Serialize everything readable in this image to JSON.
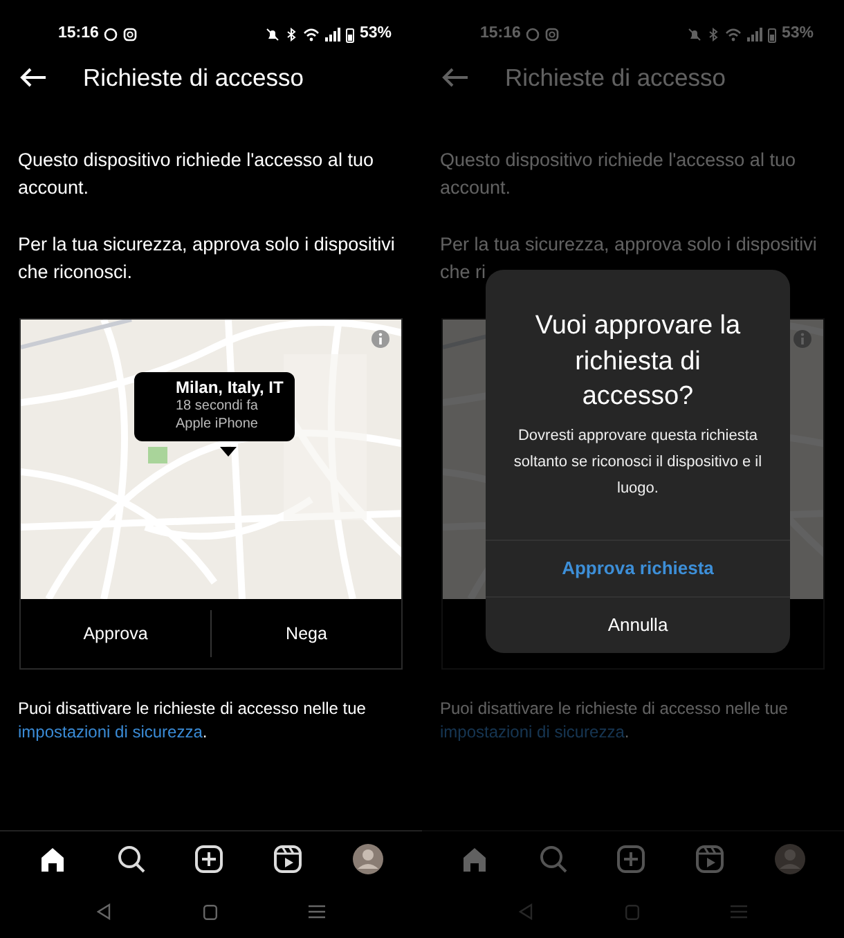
{
  "screens": [
    {
      "dimmed": false,
      "status": {
        "time": "15:16",
        "battery": "53%"
      },
      "title": "Richieste di accesso",
      "paragraphs": [
        "Questo dispositivo richiede l'accesso al tuo account.",
        "Per la tua sicurezza, approva solo i dispositivi che riconosci."
      ],
      "map": {
        "tooltip": {
          "place": "Milan, Italy, IT",
          "time": "18 secondi fa",
          "device": "Apple iPhone"
        }
      },
      "actions": [
        "Approva",
        "Nega"
      ],
      "footer": {
        "text": "Puoi disattivare le richieste di accesso nelle tue",
        "link": "impostazioni di sicurezza",
        "end": "."
      },
      "nav": [
        {
          "kind": "home",
          "selected": true
        },
        {
          "kind": "search",
          "selected": false
        },
        {
          "kind": "create",
          "selected": false
        },
        {
          "kind": "reels",
          "selected": false
        },
        {
          "kind": "profile",
          "selected": false
        }
      ]
    },
    {
      "dimmed": true,
      "status": {
        "time": "15:16",
        "battery": "53%"
      },
      "title": "Richieste di accesso",
      "paragraphs": [
        "Questo dispositivo richiede l'accesso al tuo account.",
        "Per la tua sicurezza, approva solo i dispositivi che ri"
      ],
      "footer": {
        "text": "Puoi disattivare le richieste di accesso nelle tue",
        "link": "impostazioni di sicurezza",
        "end": "."
      },
      "nav": [
        {
          "kind": "home",
          "selected": true
        },
        {
          "kind": "search",
          "selected": false
        },
        {
          "kind": "create",
          "selected": false
        },
        {
          "kind": "reels",
          "selected": false
        },
        {
          "kind": "profile",
          "selected": false
        }
      ],
      "dialog": {
        "title": "Vuoi approvare la richiesta di accesso?",
        "message": "Dovresti approvare questa richiesta soltanto se riconosci il dispositivo e il luogo.",
        "buttons": [
          {
            "label": "Approva richiesta",
            "kind": "primary"
          },
          {
            "label": "Annulla",
            "kind": "secondary"
          }
        ]
      }
    }
  ]
}
